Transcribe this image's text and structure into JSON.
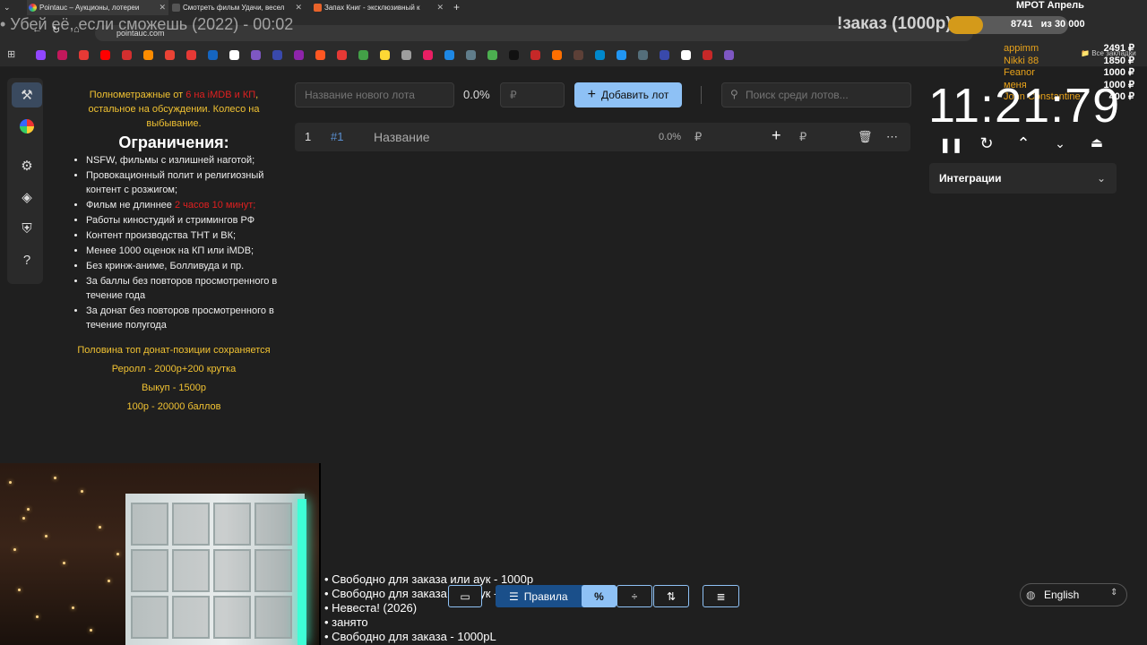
{
  "browser": {
    "tabs": [
      {
        "label": "Pointauc – Аукционы, лотереи",
        "active": true
      },
      {
        "label": "Смотреть фильм Удачи, весел",
        "active": false
      },
      {
        "label": "Запах Книг - эксклюзивный к",
        "active": false
      }
    ],
    "url": "pointauc.com",
    "all_bookmarks_label": "Все закладки"
  },
  "stream": {
    "title": "• Убей её, если сможешь (2022) - 00:02"
  },
  "overlay": {
    "order_label": "!заказ (1000р)",
    "goal_label": "МРОТ Апрель",
    "goal_current": "8741",
    "goal_text": "из 30 000",
    "goal_fraction": 0.29,
    "donors": [
      {
        "name": "appimm",
        "amount": "2491 ₽"
      },
      {
        "name": "Nikki 88",
        "amount": "1850 ₽"
      },
      {
        "name": "Feanor",
        "amount": "1000 ₽"
      },
      {
        "name": "меня",
        "amount": "1000 ₽"
      },
      {
        "name": "John Constantine",
        "amount": "400 ₽"
      }
    ]
  },
  "rules": {
    "line1_prefix": "Полнометражные от ",
    "line1_red": "6 на iMDB и КП",
    "line1_suffix": ", остальное на обсуждении. Колесо на выбывание.",
    "heading": "Ограничения:",
    "items": [
      "NSFW, фильмы с излишней наготой;",
      "Провокационный полит и религиозный контент с розжигом;",
      "Фильм не длиннее ",
      "Работы киностудий и стримингов РФ",
      "Контент производства ТНТ и ВК;",
      "Менее 1000 оценок на КП или iMDB;",
      "Без кринж-аниме, Болливуда и пр.",
      "За баллы без повторов просмотренного в течение года",
      "За донат без повторов просмотренного в течение полугода"
    ],
    "duration_red": "2 часов 10 минут;",
    "footer": [
      "Половина топ донат-позиции сохраняется",
      "Реролл - 2000р+200 крутка",
      "Выкуп - 1500р",
      "100р - 20000 баллов"
    ]
  },
  "auction": {
    "lot_name_placeholder": "Название нового лота",
    "lot_percent": "0.0%",
    "lot_price_placeholder": "₽",
    "add_lot_label": "Добавить лот",
    "search_placeholder": "Поиск среди лотов...",
    "row": {
      "index": "1",
      "id": "#1",
      "name": "Название",
      "percent": "0.0%",
      "currency": "₽",
      "add_currency": "₽"
    }
  },
  "timer": {
    "value": "11:21:79",
    "integrations_label": "Интеграции"
  },
  "captions": [
    "• Свободно для заказа или аук - 1000р",
    "• Свободно для заказа или аук - 1000р",
    "• Невеста! (2026)",
    "• занято",
    "• Свободно для заказа - 1000рL"
  ],
  "bottom_toolbar": {
    "rules_label": "Правила",
    "percent_symbol": "%"
  },
  "language": {
    "selected": "English"
  }
}
